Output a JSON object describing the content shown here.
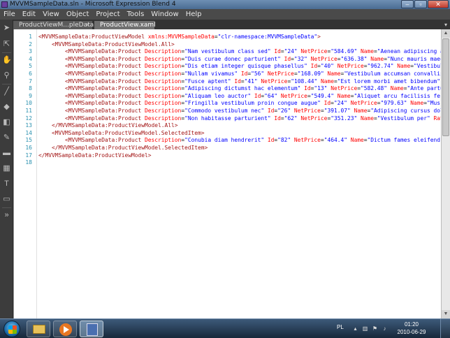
{
  "window": {
    "title": "MVVMSampleData.sln - Microsoft Expression Blend 4",
    "controls": [
      "–",
      "▫",
      "✕"
    ]
  },
  "menu": [
    "File",
    "Edit",
    "View",
    "Object",
    "Project",
    "Tools",
    "Window",
    "Help"
  ],
  "tabs": [
    {
      "label": "ProductViewM...pleData.xaml",
      "close": "×"
    },
    {
      "label": "ProductView.xaml"
    }
  ],
  "tab_overflow": "▾",
  "toolbox": [
    "selection-icon",
    "direct-selection-icon",
    "pan-icon",
    "zoom-icon",
    "eyedropper-icon",
    "paint-bucket-icon",
    "brush-transform-icon",
    "pen-icon",
    "rectangle-icon",
    "grid-icon",
    "textblock-icon",
    "button-icon",
    "asset-icon",
    "more-icon"
  ],
  "line_numbers": [
    "1",
    "2",
    "3",
    "4",
    "5",
    "6",
    "7",
    "8",
    "9",
    "10",
    "11",
    "12",
    "13",
    "14",
    "15",
    "16",
    "17",
    "18"
  ],
  "code_lines": [
    [
      [
        "k",
        "<"
      ],
      [
        "k",
        "MVVMSampleData:ProductViewModel"
      ],
      [
        "t",
        " "
      ],
      [
        "a",
        "xmlns:MVVMSampleData"
      ],
      [
        "t",
        "="
      ],
      [
        "v",
        "\"clr-namespace:MVVMSampleData\""
      ],
      [
        "k",
        ">"
      ]
    ],
    [
      [
        "t",
        "    "
      ],
      [
        "k",
        "<MVVMSampleData:ProductViewModel.All>"
      ]
    ],
    [
      [
        "t",
        "        "
      ],
      [
        "k",
        "<MVVMSampleData:Product"
      ],
      [
        "t",
        " "
      ],
      [
        "a",
        "Description"
      ],
      [
        "t",
        "="
      ],
      [
        "v",
        "\"Nam vestibulum class sed\""
      ],
      [
        "t",
        " "
      ],
      [
        "a",
        "Id"
      ],
      [
        "t",
        "="
      ],
      [
        "v",
        "\"24\""
      ],
      [
        "t",
        " "
      ],
      [
        "a",
        "NetPrice"
      ],
      [
        "t",
        "="
      ],
      [
        "v",
        "\"584.69\""
      ],
      [
        "t",
        " "
      ],
      [
        "a",
        "Name"
      ],
      [
        "t",
        "="
      ],
      [
        "v",
        "\"Aenean adipiscing aliquam cra"
      ]
    ],
    [
      [
        "t",
        "        "
      ],
      [
        "k",
        "<MVVMSampleData:Product"
      ],
      [
        "t",
        " "
      ],
      [
        "a",
        "Description"
      ],
      [
        "t",
        "="
      ],
      [
        "v",
        "\"Duis curae donec parturient\""
      ],
      [
        "t",
        " "
      ],
      [
        "a",
        "Id"
      ],
      [
        "t",
        "="
      ],
      [
        "v",
        "\"32\""
      ],
      [
        "t",
        " "
      ],
      [
        "a",
        "NetPrice"
      ],
      [
        "t",
        "="
      ],
      [
        "v",
        "\"636.38\""
      ],
      [
        "t",
        " "
      ],
      [
        "a",
        "Name"
      ],
      [
        "t",
        "="
      ],
      [
        "v",
        "\"Nunc mauris maecenas cura"
      ]
    ],
    [
      [
        "t",
        "        "
      ],
      [
        "k",
        "<MVVMSampleData:Product"
      ],
      [
        "t",
        " "
      ],
      [
        "a",
        "Description"
      ],
      [
        "t",
        "="
      ],
      [
        "v",
        "\"Dis etiam integer quisque phasellus\""
      ],
      [
        "t",
        " "
      ],
      [
        "a",
        "Id"
      ],
      [
        "t",
        "="
      ],
      [
        "v",
        "\"40\""
      ],
      [
        "t",
        " "
      ],
      [
        "a",
        "NetPrice"
      ],
      [
        "t",
        "="
      ],
      [
        "v",
        "\"962.74\""
      ],
      [
        "t",
        " "
      ],
      [
        "a",
        "Name"
      ],
      [
        "t",
        "="
      ],
      [
        "v",
        "\"Vestibulum conseq"
      ]
    ],
    [
      [
        "t",
        "        "
      ],
      [
        "k",
        "<MVVMSampleData:Product"
      ],
      [
        "t",
        " "
      ],
      [
        "a",
        "Description"
      ],
      [
        "t",
        "="
      ],
      [
        "v",
        "\"Nullam vivamus\""
      ],
      [
        "t",
        " "
      ],
      [
        "a",
        "Id"
      ],
      [
        "t",
        "="
      ],
      [
        "v",
        "\"56\""
      ],
      [
        "t",
        " "
      ],
      [
        "a",
        "NetPrice"
      ],
      [
        "t",
        "="
      ],
      [
        "v",
        "\"168.09\""
      ],
      [
        "t",
        " "
      ],
      [
        "a",
        "Name"
      ],
      [
        "t",
        "="
      ],
      [
        "v",
        "\"Vestibulum accumsan convallis dignissi"
      ]
    ],
    [
      [
        "t",
        "        "
      ],
      [
        "k",
        "<MVVMSampleData:Product"
      ],
      [
        "t",
        " "
      ],
      [
        "a",
        "Description"
      ],
      [
        "t",
        "="
      ],
      [
        "v",
        "\"Fusce aptent\""
      ],
      [
        "t",
        " "
      ],
      [
        "a",
        "Id"
      ],
      [
        "t",
        "="
      ],
      [
        "v",
        "\"41\""
      ],
      [
        "t",
        " "
      ],
      [
        "a",
        "NetPrice"
      ],
      [
        "t",
        "="
      ],
      [
        "v",
        "\"108.44\""
      ],
      [
        "t",
        " "
      ],
      [
        "a",
        "Name"
      ],
      [
        "t",
        "="
      ],
      [
        "v",
        "\"Est lorem morbi amet bibendum\""
      ],
      [
        "t",
        " "
      ],
      [
        "a",
        "Rating"
      ],
      [
        "t",
        "="
      ],
      [
        "v",
        "\"1"
      ]
    ],
    [
      [
        "t",
        "        "
      ],
      [
        "k",
        "<MVVMSampleData:Product"
      ],
      [
        "t",
        " "
      ],
      [
        "a",
        "Description"
      ],
      [
        "t",
        "="
      ],
      [
        "v",
        "\"Adipiscing dictumst hac elementum\""
      ],
      [
        "t",
        " "
      ],
      [
        "a",
        "Id"
      ],
      [
        "t",
        "="
      ],
      [
        "v",
        "\"13\""
      ],
      [
        "t",
        " "
      ],
      [
        "a",
        "NetPrice"
      ],
      [
        "t",
        "="
      ],
      [
        "v",
        "\"582.48\""
      ],
      [
        "t",
        " "
      ],
      [
        "a",
        "Name"
      ],
      [
        "t",
        "="
      ],
      [
        "v",
        "\"Ante parturient\""
      ],
      [
        "t",
        " "
      ],
      [
        "a",
        "Rat"
      ]
    ],
    [
      [
        "t",
        "        "
      ],
      [
        "k",
        "<MVVMSampleData:Product"
      ],
      [
        "t",
        " "
      ],
      [
        "a",
        "Description"
      ],
      [
        "t",
        "="
      ],
      [
        "v",
        "\"Aliquam leo auctor\""
      ],
      [
        "t",
        " "
      ],
      [
        "a",
        "Id"
      ],
      [
        "t",
        "="
      ],
      [
        "v",
        "\"64\""
      ],
      [
        "t",
        " "
      ],
      [
        "a",
        "NetPrice"
      ],
      [
        "t",
        "="
      ],
      [
        "v",
        "\"549.4\""
      ],
      [
        "t",
        " "
      ],
      [
        "a",
        "Name"
      ],
      [
        "t",
        "="
      ],
      [
        "v",
        "\"Aliquet arcu facilisis fermentum nu"
      ]
    ],
    [
      [
        "t",
        "        "
      ],
      [
        "k",
        "<MVVMSampleData:Product"
      ],
      [
        "t",
        " "
      ],
      [
        "a",
        "Description"
      ],
      [
        "t",
        "="
      ],
      [
        "v",
        "\"Fringilla vestibulum proin congue augue\""
      ],
      [
        "t",
        " "
      ],
      [
        "a",
        "Id"
      ],
      [
        "t",
        "="
      ],
      [
        "v",
        "\"24\""
      ],
      [
        "t",
        " "
      ],
      [
        "a",
        "NetPrice"
      ],
      [
        "t",
        "="
      ],
      [
        "v",
        "\"979.63\""
      ],
      [
        "t",
        " "
      ],
      [
        "a",
        "Name"
      ],
      [
        "t",
        "="
      ],
      [
        "v",
        "\"Mus blandit\""
      ],
      [
        "t",
        " "
      ]
    ],
    [
      [
        "t",
        "        "
      ],
      [
        "k",
        "<MVVMSampleData:Product"
      ],
      [
        "t",
        " "
      ],
      [
        "a",
        "Description"
      ],
      [
        "t",
        "="
      ],
      [
        "v",
        "\"Commodo vestibulum nec\""
      ],
      [
        "t",
        " "
      ],
      [
        "a",
        "Id"
      ],
      [
        "t",
        "="
      ],
      [
        "v",
        "\"26\""
      ],
      [
        "t",
        " "
      ],
      [
        "a",
        "NetPrice"
      ],
      [
        "t",
        "="
      ],
      [
        "v",
        "\"391.07\""
      ],
      [
        "t",
        " "
      ],
      [
        "a",
        "Name"
      ],
      [
        "t",
        "="
      ],
      [
        "v",
        "\"Adipiscing cursus dolor\""
      ],
      [
        "t",
        " "
      ],
      [
        "a",
        "Ratin"
      ]
    ],
    [
      [
        "t",
        "        "
      ],
      [
        "k",
        "<MVVMSampleData:Product"
      ],
      [
        "t",
        " "
      ],
      [
        "a",
        "Description"
      ],
      [
        "t",
        "="
      ],
      [
        "v",
        "\"Non habitasse parturient\""
      ],
      [
        "t",
        " "
      ],
      [
        "a",
        "Id"
      ],
      [
        "t",
        "="
      ],
      [
        "v",
        "\"62\""
      ],
      [
        "t",
        " "
      ],
      [
        "a",
        "NetPrice"
      ],
      [
        "t",
        "="
      ],
      [
        "v",
        "\"351.23\""
      ],
      [
        "t",
        " "
      ],
      [
        "a",
        "Name"
      ],
      [
        "t",
        "="
      ],
      [
        "v",
        "\"Vestibulum per\""
      ],
      [
        "t",
        " "
      ],
      [
        "a",
        "Rating"
      ],
      [
        "t",
        "="
      ],
      [
        "v",
        "\"0\""
      ],
      [
        "t",
        " "
      ],
      [
        "a",
        "B"
      ]
    ],
    [
      [
        "t",
        "    "
      ],
      [
        "k",
        "</MVVMSampleData:ProductViewModel.All>"
      ]
    ],
    [
      [
        "t",
        "    "
      ],
      [
        "k",
        "<MVVMSampleData:ProductViewModel.SelectedItem>"
      ]
    ],
    [
      [
        "t",
        "        "
      ],
      [
        "k",
        "<MVVMSampleData:Product"
      ],
      [
        "t",
        " "
      ],
      [
        "a",
        "Description"
      ],
      [
        "t",
        "="
      ],
      [
        "v",
        "\"Conubia diam hendrerit\""
      ],
      [
        "t",
        " "
      ],
      [
        "a",
        "Id"
      ],
      [
        "t",
        "="
      ],
      [
        "v",
        "\"82\""
      ],
      [
        "t",
        " "
      ],
      [
        "a",
        "NetPrice"
      ],
      [
        "t",
        "="
      ],
      [
        "v",
        "\"464.4\""
      ],
      [
        "t",
        " "
      ],
      [
        "a",
        "Name"
      ],
      [
        "t",
        "="
      ],
      [
        "v",
        "\"Dictum fames eleifend felis\""
      ],
      [
        "t",
        " "
      ],
      [
        "a",
        "Ratin"
      ]
    ],
    [
      [
        "t",
        "    "
      ],
      [
        "k",
        "</MVVMSampleData:ProductViewModel.SelectedItem>"
      ]
    ],
    [
      [
        "k",
        "</MVVMSampleData:ProductViewModel>"
      ]
    ],
    [
      [
        "t",
        ""
      ]
    ]
  ],
  "scrollbar": {
    "up": "▲",
    "down": "▼"
  },
  "taskbar": {
    "items": [
      "explorer-folder-icon",
      "media-player-icon",
      "expression-blend-icon"
    ],
    "lang": "PL",
    "tray_icons": [
      "chevron-up-icon",
      "network-icon",
      "flag-icon",
      "volume-icon"
    ],
    "time": "01:20",
    "date": "2010-06-29"
  }
}
